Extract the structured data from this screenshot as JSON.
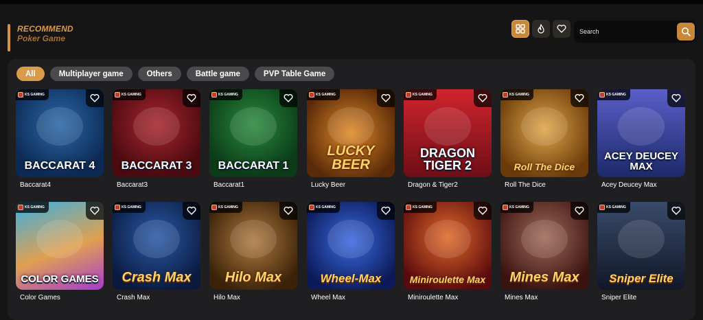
{
  "header": {
    "title_line1": "RECOMMEND",
    "title_line2": "Poker Game",
    "search_placeholder": "Search",
    "icons": [
      "grid-icon",
      "fire-icon",
      "heart-icon",
      "search-icon"
    ]
  },
  "tabs": [
    {
      "label": "All",
      "active": true
    },
    {
      "label": "Multiplayer game",
      "active": false
    },
    {
      "label": "Others",
      "active": false
    },
    {
      "label": "Battle game",
      "active": false
    },
    {
      "label": "PVP Table Game",
      "active": false
    }
  ],
  "provider_badge": "KS GAMING",
  "games": [
    {
      "name": "Baccarat4",
      "art_title": "BACCARAT 4"
    },
    {
      "name": "Baccarat3",
      "art_title": "BACCARAT 3"
    },
    {
      "name": "Baccarat1",
      "art_title": "BACCARAT 1"
    },
    {
      "name": "Lucky Beer",
      "art_title": "LUCKY BEER"
    },
    {
      "name": "Dragon & Tiger2",
      "art_title": "DRAGON TIGER 2"
    },
    {
      "name": "Roll The Dice",
      "art_title": "Roll The Dice"
    },
    {
      "name": "Acey Deucey Max",
      "art_title": "ACEY DEUCEY MAX"
    },
    {
      "name": "Color Games",
      "art_title": "COLOR GAMES"
    },
    {
      "name": "Crash Max",
      "art_title": "Crash Max"
    },
    {
      "name": "Hilo Max",
      "art_title": "Hilo Max"
    },
    {
      "name": "Wheel Max",
      "art_title": "Wheel-Max"
    },
    {
      "name": "Miniroulette Max",
      "art_title": "Miniroulette Max"
    },
    {
      "name": "Mines Max",
      "art_title": "Mines Max"
    },
    {
      "name": "Sniper Elite",
      "art_title": "Sniper Elite"
    }
  ],
  "colors": {
    "accent": "#d99a4a",
    "panel": "#1f1f21",
    "background": "#151515"
  }
}
